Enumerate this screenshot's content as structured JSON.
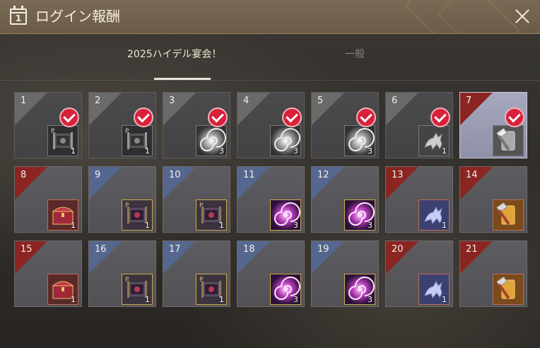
{
  "window": {
    "title": "ログイン報酬",
    "calendar_icon_digit": "1",
    "icon": "calendar-icon",
    "close_icon": "close-icon"
  },
  "tabs": [
    {
      "label": "2025ハイデル宴会！",
      "selected": true
    },
    {
      "label": "一般",
      "selected": false
    }
  ],
  "colors": {
    "titlebar": "#6a5b48",
    "claimed_check": "#d8213a",
    "corner_red": "#8b2522",
    "corner_blue": "#55678f",
    "current_day": "#a7a8bd"
  },
  "days": [
    {
      "day": "1",
      "status": "claimed",
      "corner": "grey",
      "item": "scroll-icon",
      "frame": "dim",
      "qty": "1"
    },
    {
      "day": "2",
      "status": "claimed",
      "corner": "grey",
      "item": "scroll-icon",
      "frame": "dim",
      "qty": "1"
    },
    {
      "day": "3",
      "status": "claimed",
      "corner": "grey",
      "item": "spiral-orb-icon",
      "frame": "dim",
      "qty": "3"
    },
    {
      "day": "4",
      "status": "claimed",
      "corner": "grey",
      "item": "spiral-orb-icon",
      "frame": "dim",
      "qty": "3"
    },
    {
      "day": "5",
      "status": "claimed",
      "corner": "grey",
      "item": "spiral-orb-icon",
      "frame": "dim",
      "qty": "3"
    },
    {
      "day": "6",
      "status": "claimed",
      "corner": "grey",
      "item": "pegasus-icon",
      "frame": "dim",
      "qty": "1"
    },
    {
      "day": "7",
      "status": "claimed-current",
      "corner": "red",
      "item": "hammer-scroll-icon",
      "frame": "dim",
      "qty": ""
    },
    {
      "day": "8",
      "status": "locked",
      "corner": "red",
      "item": "treasure-chest-icon",
      "frame": "red",
      "qty": "1"
    },
    {
      "day": "9",
      "status": "locked",
      "corner": "blue",
      "item": "scroll-icon",
      "frame": "purple",
      "qty": "1"
    },
    {
      "day": "10",
      "status": "locked",
      "corner": "blue",
      "item": "scroll-icon",
      "frame": "purple",
      "qty": "1"
    },
    {
      "day": "11",
      "status": "locked",
      "corner": "blue",
      "item": "spiral-orb-icon",
      "frame": "purple",
      "qty": "3"
    },
    {
      "day": "12",
      "status": "locked",
      "corner": "blue",
      "item": "spiral-orb-icon",
      "frame": "purple",
      "qty": "3"
    },
    {
      "day": "13",
      "status": "locked",
      "corner": "red",
      "item": "pegasus-icon",
      "frame": "red",
      "qty": "1"
    },
    {
      "day": "14",
      "status": "locked",
      "corner": "red",
      "item": "hammer-scroll-icon",
      "frame": "red",
      "qty": ""
    },
    {
      "day": "15",
      "status": "locked",
      "corner": "red",
      "item": "treasure-chest-icon",
      "frame": "red",
      "qty": "1"
    },
    {
      "day": "16",
      "status": "locked",
      "corner": "blue",
      "item": "scroll-icon",
      "frame": "purple",
      "qty": "1"
    },
    {
      "day": "17",
      "status": "locked",
      "corner": "blue",
      "item": "scroll-icon",
      "frame": "purple",
      "qty": "1"
    },
    {
      "day": "18",
      "status": "locked",
      "corner": "blue",
      "item": "spiral-orb-icon",
      "frame": "purple",
      "qty": "3"
    },
    {
      "day": "19",
      "status": "locked",
      "corner": "blue",
      "item": "spiral-orb-icon",
      "frame": "purple",
      "qty": "3"
    },
    {
      "day": "20",
      "status": "locked",
      "corner": "red",
      "item": "pegasus-icon",
      "frame": "red",
      "qty": "1"
    },
    {
      "day": "21",
      "status": "locked",
      "corner": "red",
      "item": "hammer-scroll-icon",
      "frame": "red",
      "qty": ""
    }
  ]
}
